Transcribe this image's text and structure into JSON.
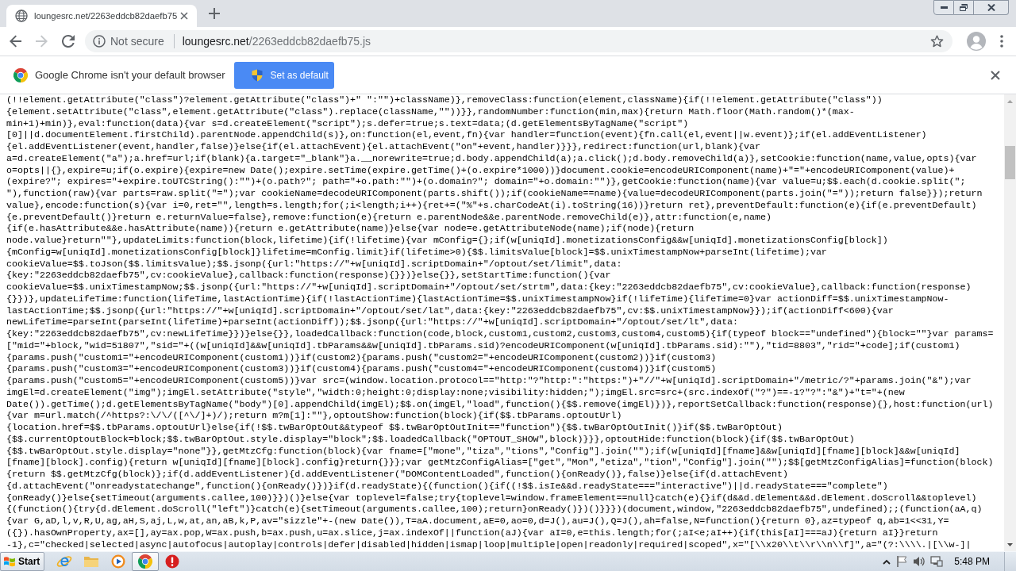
{
  "browser": {
    "tab": {
      "title": "loungesrc.net/2263eddcb82daefb75",
      "selected": true
    },
    "nav_buttons": [
      {
        "kind": "back",
        "disabled": false
      },
      {
        "kind": "forward",
        "disabled": true
      },
      {
        "kind": "reload",
        "disabled": false
      }
    ],
    "address_bar": {
      "security": "Not secure",
      "host": "loungesrc.net",
      "path": "/2263eddcb82daefb75.js"
    },
    "infobar": {
      "message": "Google Chrome isn't your default browser",
      "button": "Set as default"
    }
  },
  "code_lines": [
    "(!!element.getAttribute(\"class\")?element.getAttribute(\"class\")+\" \":\"\")+className)},removeClass:function(element,className){if(!!element.getAttribute(\"class\"))",
    "{element.setAttribute(\"class\",element.getAttribute(\"class\").replace(className,\"\"))}},randomNumber:function(min,max){return Math.floor(Math.random()*(max-",
    "min+1)+min)},eval:function(data){var s=d.createElement(\"script\");s.defer=true;s.text=data;(d.getElementsByTagName(\"script\")",
    "[0]||d.documentElement.firstChild).parentNode.appendChild(s)},on:function(el,event,fn){var handler=function(event){fn.call(el,event||w.event)};if(el.addEventListener)",
    "{el.addEventListener(event,handler,false)}else{if(el.attachEvent){el.attachEvent(\"on\"+event,handler)}}},redirect:function(url,blank){var",
    "a=d.createElement(\"a\");a.href=url;if(blank){a.target=\"_blank\"}a.__norewrite=true;d.body.appendChild(a);a.click();d.body.removeChild(a)},setCookie:function(name,value,opts){var",
    "o=opts||{},expire=u;if(o.expire){expire=new Date();expire.setTime(expire.getTime()+(o.expire*1000))}document.cookie=encodeURIComponent(name)+\"=\"+encodeURIComponent(value)+",
    "(expire?\"; expires=\"+expire.toUTCString():\"\")+(o.path?\"; path=\"+o.path:\"\")+(o.domain?\"; domain=\"+o.domain:\"\")},getCookie:function(name){var value=u;$$.each(d.cookie.split(\";",
    "\"),function(raw){var parts=raw.split(\"=\");var cookieName=decodeURIComponent(parts.shift());if(cookieName==name){value=decodeURIComponent(parts.join(\"=\"));return false}});return",
    "value},encode:function(s){var i=0,ret=\"\",length=s.length;for(;i<length;i++){ret+=(\"%\"+s.charCodeAt(i).toString(16))}return ret},preventDefault:function(e){if(e.preventDefault)",
    "{e.preventDefault()}return e.returnValue=false},remove:function(e){return e.parentNode&&e.parentNode.removeChild(e)},attr:function(e,name)",
    "{if(e.hasAttribute&&e.hasAttribute(name)){return e.getAttribute(name)}else{var node=e.getAttributeNode(name);if(node){return",
    "node.value}return\"\"},updateLimits:function(block,lifetime){if(!lifetime){var mConfig={};if(w[uniqId].monetizationsConfig&&w[uniqId].monetizationsConfig[block])",
    "{mConfig=w[uniqId].monetizationsConfig[block]}lifetime=mConfig.limit}if(lifetime>0){$$.limitsValue[block]=$$.unixTimestampNow+parseInt(lifetime);var",
    "cookieValue=$$.toJson($$.limitsValue);$$.jsonp({url:\"https://\"+w[uniqId].scriptDomain+\"/optout/set/limit\",data:",
    "{key:\"2263eddcb82daefb75\",cv:cookieValue},callback:function(response){}})}else{}},setStartTime:function(){var",
    "cookieValue=$$.unixTimestampNow;$$.jsonp({url:\"https://\"+w[uniqId].scriptDomain+\"/optout/set/strtm\",data:{key:\"2263eddcb82daefb75\",cv:cookieValue},callback:function(response)",
    "{}})},updateLifeTime:function(lifeTime,lastActionTime){if(!lastActionTime){lastActionTime=$$.unixTimestampNow}if(!lifeTime){lifeTime=0}var actionDiff=$$.unixTimestampNow-",
    "lastActionTime;$$.jsonp({url:\"https://\"+w[uniqId].scriptDomain+\"/optout/set/lat\",data:{key:\"2263eddcb82daefb75\",cv:$$.unixTimestampNow}});if(actionDiff<600){var",
    "newLifeTime=parseInt(parseInt(lifeTime)+parseInt(actionDiff));$$.jsonp({url:\"https://\"+w[uniqId].scriptDomain+\"/optout/set/lt\",data:",
    "{key:\"2263eddcb82daefb75\",cv:newLifeTime}})}else{}},loadedCallback:function(code,block,custom1,custom2,custom3,custom4,custom5){if(typeof block==\"undefined\"){block=\"\"}var params=",
    "[\"mid=\"+block,\"wid=51807\",\"sid=\"+((w[uniqId]&&w[uniqId].tbParams&&w[uniqId].tbParams.sid)?encodeURIComponent(w[uniqId].tbParams.sid):\"\"),\"tid=8803\",\"rid=\"+code];if(custom1)",
    "{params.push(\"custom1=\"+encodeURIComponent(custom1))}if(custom2){params.push(\"custom2=\"+encodeURIComponent(custom2))}if(custom3)",
    "{params.push(\"custom3=\"+encodeURIComponent(custom3))}if(custom4){params.push(\"custom4=\"+encodeURIComponent(custom4))}if(custom5)",
    "{params.push(\"custom5=\"+encodeURIComponent(custom5))}var src=(window.location.protocol==\"http:\"?\"http:\":\"https:\")+\"//\"+w[uniqId].scriptDomain+\"/metric/?\"+params.join(\"&\");var",
    "imgEl=d.createElement(\"img\");imgEl.setAttribute(\"style\",\"width:0;height:0;display:none;visibility:hidden;\");imgEl.src=src+(src.indexOf(\"?\")==-1?\"?\":\"&\")+\"t=\"+(new",
    "Date()).getTime();d.getElementsByTagName(\"body\")[0].appendChild(imgEl);$$.on(imgEl,\"load\",function(){$$.remove(imgEl)})},reportSetCallback:function(response){},host:function(url)",
    "{var m=url.match(/^https?:\\/\\/([^\\/]+)/);return m?m[1]:\"\"},optoutShow:function(block){if($$.tbParams.optoutUrl)",
    "{location.href=$$.tbParams.optoutUrl}else{if(!$$.twBarOptOut&&typeof $$.twBarOptOutInit==\"function\"){$$.twBarOptOutInit()}if($$.twBarOptOut)",
    "{$$.currentOptoutBlock=block;$$.twBarOptOut.style.display=\"block\";$$.loadedCallback(\"OPTOUT_SHOW\",block)}}},optoutHide:function(block){if($$.twBarOptOut)",
    "{$$.twBarOptOut.style.display=\"none\"}},getMtzCfg:function(block){var fname=[\"mone\",\"tiza\",\"tions\",\"Config\"].join(\"\");if(w[uniqId][fname]&&w[uniqId][fname][block]&&w[uniqId]",
    "[fname][block].config){return w[uniqId][fname][block].config}return{}}};var getMtzConfigAlias=[\"get\",\"Mon\",\"etiza\",\"tion\",\"Config\"].join(\"\");$$[getMtzConfigAlias]=function(block)",
    "{return $$.getMtzCfg(block)};if(d.addEventListener){d.addEventListener(\"DOMContentLoaded\",function(){onReady()},false)}else{if(d.attachEvent)",
    "{d.attachEvent(\"onreadystatechange\",function(){onReady()})}if(d.readyState){(function(){if((!$$.isIe&&d.readyState===\"interactive\")||d.readyState===\"complete\")",
    "{onReady()}else{setTimeout(arguments.callee,100)}})()}else{var toplevel=false;try{toplevel=window.frameElement==null}catch(e){}if(d&&d.dElement&&d.dElement.doScroll&&toplevel)",
    "{(function(){try{d.dElement.doScroll(\"left\")}catch(e){setTimeout(arguments.callee,100);return}onReady()})()}}})(document,window,\"2263eddcb82daefb75\",undefined);;(function(aA,q)",
    "{var G,aD,l,v,R,U,ag,aH,S,aj,L,w,at,an,aB,k,P,av=\"sizzle\"+-(new Date()),T=aA.document,aE=0,ao=0,d=J(),au=J(),Q=J(),ah=false,N=function(){return 0},az=typeof q,ab=1<<31,Y=",
    "({}).hasOwnProperty,ax=[],ay=ax.pop,W=ax.push,b=ax.push,u=ax.slice,j=ax.indexOf||function(aJ){var aI=0,e=this.length;for(;aI<e;aI++){if(this[aI]===aJ){return aI}}return",
    "-1},c=\"checked|selected|async|autofocus|autoplay|controls|defer|disabled|hidden|ismap|loop|multiple|open|readonly|required|scoped\",x=\"[\\\\x20\\\\t\\\\r\\\\n\\\\f]\",a=\"(?:\\\\\\\\.|[\\\\w-]|"
  ],
  "taskbar": {
    "start": "Start",
    "apps": [
      {
        "kind": "ie",
        "selected": false
      },
      {
        "kind": "folder",
        "selected": false
      },
      {
        "kind": "media",
        "selected": false
      },
      {
        "kind": "chrome",
        "selected": true
      },
      {
        "kind": "alert",
        "selected": false
      }
    ],
    "clock": "5:48 PM"
  }
}
